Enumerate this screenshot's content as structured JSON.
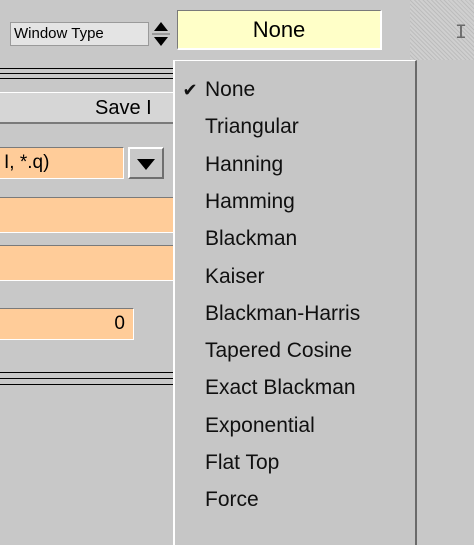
{
  "window_type": {
    "label": "Window Type",
    "value": "None",
    "hatch_glyph": "I"
  },
  "panel": {
    "save_label": "Save I",
    "expression": "I, *.q)",
    "number_value": "0"
  },
  "menu": {
    "checked_item": "None",
    "items": [
      "None",
      "Triangular",
      "Hanning",
      "Hamming",
      "Blackman",
      "Kaiser",
      "Blackman-Harris",
      "Tapered Cosine",
      "Exact Blackman",
      "Exponential",
      "Flat Top",
      "Force"
    ]
  },
  "colors": {
    "background": "#c8c8c8",
    "field_yellow": "#ffffc8",
    "field_orange": "#ffcc99"
  }
}
